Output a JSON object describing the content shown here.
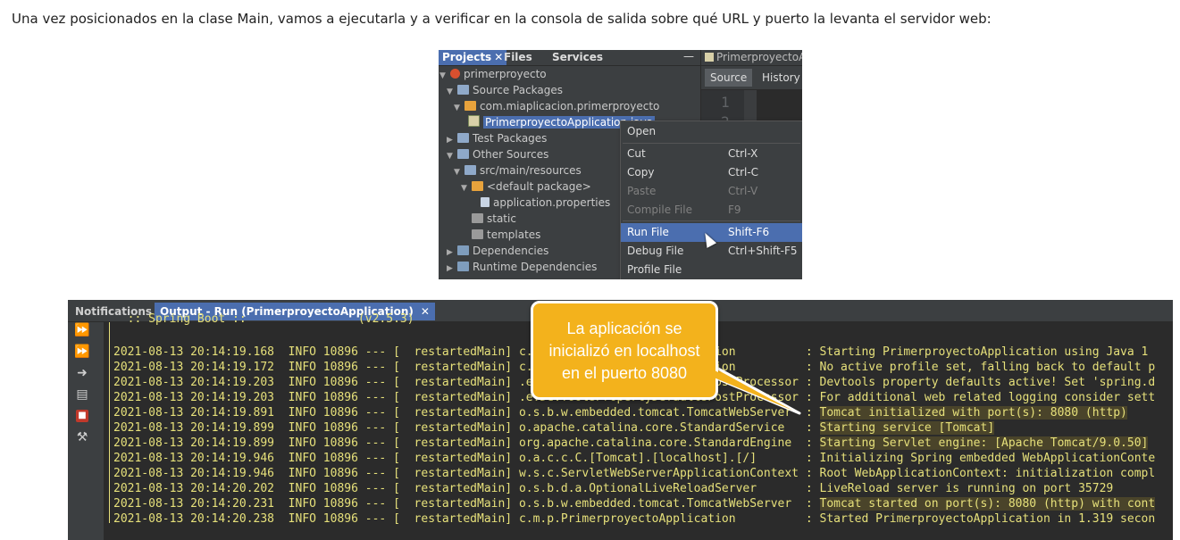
{
  "intro_text": "Una vez posicionados en la clase Main, vamos a ejecutarla y a verificar en la consola de salida sobre qué URL y puerto la levanta el servidor web:",
  "ide": {
    "panel_tabs": [
      "Projects",
      "Files",
      "Services"
    ],
    "close_glyph": "✕",
    "minimize_glyph": "—",
    "tree": [
      {
        "label": "primerproyecto",
        "arrow": "▼",
        "icon": "project-icon"
      },
      {
        "label": "Source Packages",
        "arrow": "▼",
        "icon": "folder-icon"
      },
      {
        "label": "com.miaplicacion.primerproyecto",
        "arrow": "▼",
        "icon": "package-icon"
      },
      {
        "label": "PrimerproyectoApplication.java",
        "arrow": "",
        "icon": "java-file-icon",
        "selected": true
      },
      {
        "label": "Test Packages",
        "arrow": "▶",
        "icon": "folder-icon"
      },
      {
        "label": "Other Sources",
        "arrow": "▼",
        "icon": "folder-icon"
      },
      {
        "label": "src/main/resources",
        "arrow": "▼",
        "icon": "folder-icon"
      },
      {
        "label": "<default package>",
        "arrow": "▼",
        "icon": "package-icon"
      },
      {
        "label": "application.properties",
        "arrow": "",
        "icon": "properties-file-icon"
      },
      {
        "label": "static",
        "arrow": "",
        "icon": "directory-icon"
      },
      {
        "label": "templates",
        "arrow": "",
        "icon": "directory-icon"
      },
      {
        "label": "Dependencies",
        "arrow": "▶",
        "icon": "library-icon"
      },
      {
        "label": "Runtime Dependencies",
        "arrow": "▶",
        "icon": "library-icon"
      }
    ],
    "editor": {
      "tab_label": "PrimerproyectoA",
      "source_label": "Source",
      "history_label": "History",
      "line_numbers": [
        "1",
        "2"
      ]
    },
    "context_menu": [
      {
        "label": "Open",
        "shortcut": "",
        "disabled": false
      },
      {
        "label": "Cut",
        "shortcut": "Ctrl-X",
        "disabled": false
      },
      {
        "label": "Copy",
        "shortcut": "Ctrl-C",
        "disabled": false
      },
      {
        "label": "Paste",
        "shortcut": "Ctrl-V",
        "disabled": true
      },
      {
        "label": "Compile File",
        "shortcut": "F9",
        "disabled": true
      },
      {
        "label": "Run File",
        "shortcut": "Shift-F6",
        "disabled": false,
        "highlighted": true
      },
      {
        "label": "Debug File",
        "shortcut": "Ctrl+Shift-F5",
        "disabled": false
      },
      {
        "label": "Profile File",
        "shortcut": "",
        "disabled": false
      }
    ]
  },
  "output": {
    "tabs": [
      "Notifications",
      "Output - Run (PrimerproyectoApplication)"
    ],
    "close_glyph": "✕",
    "clipped_line": "  :: Spring Boot ::                (v2.5.3)",
    "log": [
      {
        "ts": "2021-08-13 20:14:19.168",
        "level": "INFO",
        "pid": "10896",
        "thread": "restartedMain",
        "logger": "c.m.p.PrimerproyectoApplication         ",
        "msg": "Starting PrimerproyectoApplication using Java 1",
        "hl": false
      },
      {
        "ts": "2021-08-13 20:14:19.172",
        "level": "INFO",
        "pid": "10896",
        "thread": "restartedMain",
        "logger": "c.m.p.PrimerproyectoApplication         ",
        "msg": "No active profile set, falling back to default p",
        "hl": false
      },
      {
        "ts": "2021-08-13 20:14:19.203",
        "level": "INFO",
        "pid": "10896",
        "thread": "restartedMain",
        "logger": ".e.DevToolsPropertyDefaultsPostProcessor",
        "msg": "Devtools property defaults active! Set 'spring.d",
        "hl": false
      },
      {
        "ts": "2021-08-13 20:14:19.203",
        "level": "INFO",
        "pid": "10896",
        "thread": "restartedMain",
        "logger": ".e.DevToolsPropertyDefaultsPostProcessor",
        "msg": "For additional web related logging consider sett",
        "hl": false
      },
      {
        "ts": "2021-08-13 20:14:19.891",
        "level": "INFO",
        "pid": "10896",
        "thread": "restartedMain",
        "logger": "o.s.b.w.embedded.tomcat.TomcatWebServer ",
        "msg": "Tomcat initialized with port(s): 8080 (http)",
        "hl": true
      },
      {
        "ts": "2021-08-13 20:14:19.899",
        "level": "INFO",
        "pid": "10896",
        "thread": "restartedMain",
        "logger": "o.apache.catalina.core.StandardService  ",
        "msg": "Starting service [Tomcat]",
        "hl": true
      },
      {
        "ts": "2021-08-13 20:14:19.899",
        "level": "INFO",
        "pid": "10896",
        "thread": "restartedMain",
        "logger": "org.apache.catalina.core.StandardEngine ",
        "msg": "Starting Servlet engine: [Apache Tomcat/9.0.50]",
        "hl": true
      },
      {
        "ts": "2021-08-13 20:14:19.946",
        "level": "INFO",
        "pid": "10896",
        "thread": "restartedMain",
        "logger": "o.a.c.c.C.[Tomcat].[localhost].[/]      ",
        "msg": "Initializing Spring embedded WebApplicationConte",
        "hl": false
      },
      {
        "ts": "2021-08-13 20:14:19.946",
        "level": "INFO",
        "pid": "10896",
        "thread": "restartedMain",
        "logger": "w.s.c.ServletWebServerApplicationContext",
        "msg": "Root WebApplicationContext: initialization compl",
        "hl": false
      },
      {
        "ts": "2021-08-13 20:14:20.202",
        "level": "INFO",
        "pid": "10896",
        "thread": "restartedMain",
        "logger": "o.s.b.d.a.OptionalLiveReloadServer      ",
        "msg": "LiveReload server is running on port 35729",
        "hl": false
      },
      {
        "ts": "2021-08-13 20:14:20.231",
        "level": "INFO",
        "pid": "10896",
        "thread": "restartedMain",
        "logger": "o.s.b.w.embedded.tomcat.TomcatWebServer ",
        "msg": "Tomcat started on port(s): 8080 (http) with cont",
        "hl": true
      },
      {
        "ts": "2021-08-13 20:14:20.238",
        "level": "INFO",
        "pid": "10896",
        "thread": "restartedMain",
        "logger": "c.m.p.PrimerproyectoApplication         ",
        "msg": "Started PrimerproyectoApplication in 1.319 secon",
        "hl": false
      }
    ]
  },
  "callout": {
    "text_lines": [
      "La aplicación se",
      "inicializó en localhost",
      "en el puerto 8080"
    ],
    "color": "#f3b21c"
  }
}
